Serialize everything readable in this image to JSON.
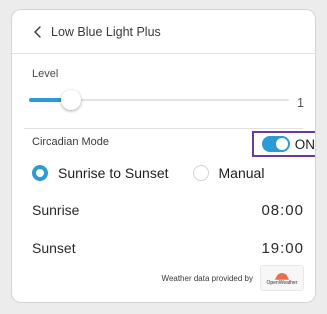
{
  "header": {
    "title": "Low Blue Light Plus",
    "back_icon": "chevron-left-icon"
  },
  "level": {
    "label": "Level",
    "value": "1",
    "fraction": 0.16
  },
  "circadian": {
    "label": "Circadian Mode",
    "toggle_state": "ON",
    "toggle_on": true
  },
  "schedule": {
    "options": [
      {
        "label": "Sunrise to Sunset",
        "selected": true
      },
      {
        "label": "Manual",
        "selected": false
      }
    ]
  },
  "times": {
    "sunrise_label": "Sunrise",
    "sunrise_value": "08:00",
    "sunset_label": "Sunset",
    "sunset_value": "19:00"
  },
  "footer": {
    "credit_text": "Weather data provided by",
    "logo_text": "OpenWeather"
  },
  "colors": {
    "accent": "#2b9bd8",
    "highlight_border": "#6a3aa0",
    "logo_orange": "#eb6e4b"
  }
}
